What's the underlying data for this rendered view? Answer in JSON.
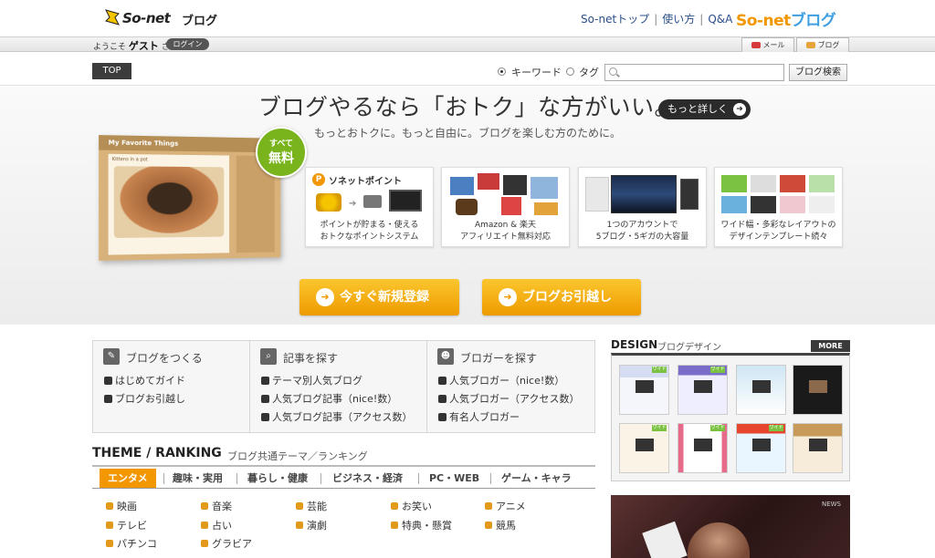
{
  "header": {
    "logo_text": "So-net",
    "logo_sub": "ブログ",
    "nav": [
      "So-netトップ",
      "使い方",
      "Q&A"
    ],
    "brand_a": "So-net",
    "brand_b": "ブログ",
    "colors": {
      "accent": "#f39700",
      "brand_blue": "#3ea0e0",
      "link": "#2a4f8a"
    }
  },
  "userbar": {
    "welcome_prefix": "ようこそ",
    "guest": "ゲスト",
    "suffix": "さん",
    "login": "ログイン",
    "mail": "メール",
    "blog": "ブログ"
  },
  "search": {
    "top_label": "TOP",
    "opt_keyword": "キーワード",
    "opt_tag": "タグ",
    "button": "ブログ検索",
    "value": ""
  },
  "hero": {
    "title": "ブログやるなら「おトク」な方がいい。",
    "more": "もっと詳しく",
    "subtitle": "もっとおトクに。もっと自由に。ブログを楽しむ方のために。",
    "mock_title": "My Favorite Things",
    "mock_post": "Kittens in a pot",
    "badge_small": "すべて",
    "badge_big": "無料",
    "cards": [
      {
        "line1": "ポイントが貯まる・使える",
        "line2": "おトクなポイントシステム",
        "logo": "ソネットポイント"
      },
      {
        "line1": "Amazon & 楽天",
        "line2": "アフィリエイト無料対応"
      },
      {
        "line1": "1つのアカウントで",
        "line2": "5ブログ・5ギガの大容量"
      },
      {
        "line1": "ワイド幅・多彩なレイアウトの",
        "line2": "デザインテンプレート続々"
      }
    ],
    "cta_register": "今すぐ新規登録",
    "cta_move": "ブログお引越し"
  },
  "nav": {
    "col1": {
      "head": "ブログをつくる",
      "links": [
        "はじめてガイド",
        "ブログお引越し"
      ]
    },
    "col2": {
      "head": "記事を探す",
      "links": [
        "テーマ別人気ブログ",
        "人気ブログ記事（nice!数）",
        "人気ブログ記事（アクセス数）"
      ]
    },
    "col3": {
      "head": "ブロガーを探す",
      "links": [
        "人気ブロガー（nice!数）",
        "人気ブロガー（アクセス数）",
        "有名人ブロガー"
      ]
    }
  },
  "theme": {
    "title": "THEME / RANKING",
    "subtitle": "ブログ共通テーマ／ランキング",
    "tabs": [
      "エンタメ",
      "趣味・実用",
      "暮らし・健康",
      "ビジネス・経済",
      "PC・WEB",
      "ゲーム・キャラ"
    ],
    "categories": [
      "映画",
      "音楽",
      "芸能",
      "お笑い",
      "アニメ",
      "テレビ",
      "占い",
      "演劇",
      "特典・懸賞",
      "競馬",
      "パチンコ",
      "グラビア"
    ]
  },
  "design": {
    "title": "DESIGN",
    "subtitle": "ブログデザイン",
    "more": "MORE",
    "tag": "ワイド",
    "video_logo": "NEWS"
  }
}
